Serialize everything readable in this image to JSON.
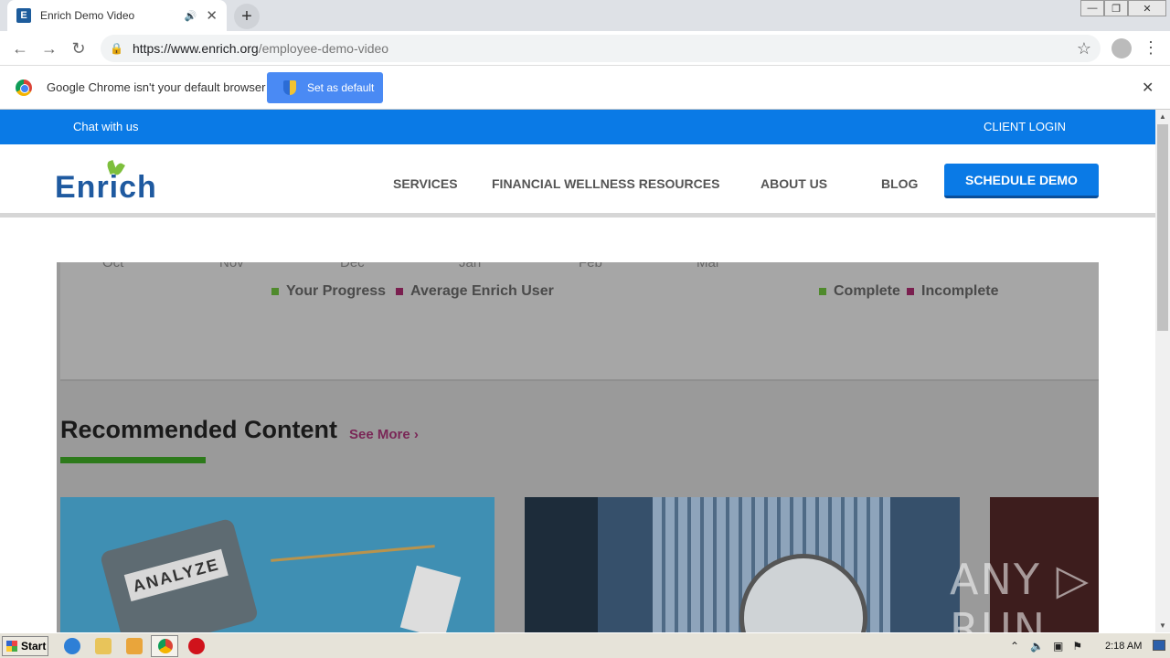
{
  "browser": {
    "tab": {
      "favicon_letter": "E",
      "title": "Enrich Demo Video",
      "audio_icon": "🔊",
      "close_glyph": "✕"
    },
    "new_tab_glyph": "+",
    "window_controls": {
      "minimize": "—",
      "restore": "❐",
      "close": "✕"
    },
    "nav": {
      "back": "←",
      "forward": "→",
      "reload": "↻"
    },
    "url": {
      "host": "https://www.enrich.org",
      "path": "/employee-demo-video"
    },
    "bookmark_glyph": "☆",
    "menu_glyph": "⋮"
  },
  "infobar": {
    "message": "Google Chrome isn't your default browser",
    "set_default_label": "Set as default",
    "close_glyph": "✕"
  },
  "site": {
    "topbar": {
      "chat": "Chat with us",
      "login": "CLIENT LOGIN"
    },
    "logo": {
      "text": "Enrich"
    },
    "nav": [
      {
        "label": "SERVICES"
      },
      {
        "label": "FINANCIAL WELLNESS RESOURCES"
      },
      {
        "label": "ABOUT US"
      },
      {
        "label": "BLOG"
      }
    ],
    "cta": "SCHEDULE DEMO"
  },
  "video": {
    "months": [
      "Oct",
      "Nov",
      "Dec",
      "Jan",
      "Feb",
      "Mar"
    ],
    "legend_left": [
      {
        "label": "Your Progress",
        "color": "#4f8a2c"
      },
      {
        "label": "Average Enrich User",
        "color": "#7a1f4f"
      }
    ],
    "legend_right": [
      {
        "label": "Complete",
        "color": "#4f8a2c"
      },
      {
        "label": "Incomplete",
        "color": "#7a1f4f"
      }
    ],
    "section_title": "Recommended Content",
    "see_more": "See More ›",
    "card1_screen": "ANALYZE",
    "watermark": "ANY ▷ RUN"
  },
  "taskbar": {
    "start_label": "Start",
    "time": "2:18 AM"
  },
  "colors": {
    "brand_blue": "#0a7ae6",
    "logo_blue": "#1f5aa0",
    "leaf_green": "#7dbf3c"
  }
}
